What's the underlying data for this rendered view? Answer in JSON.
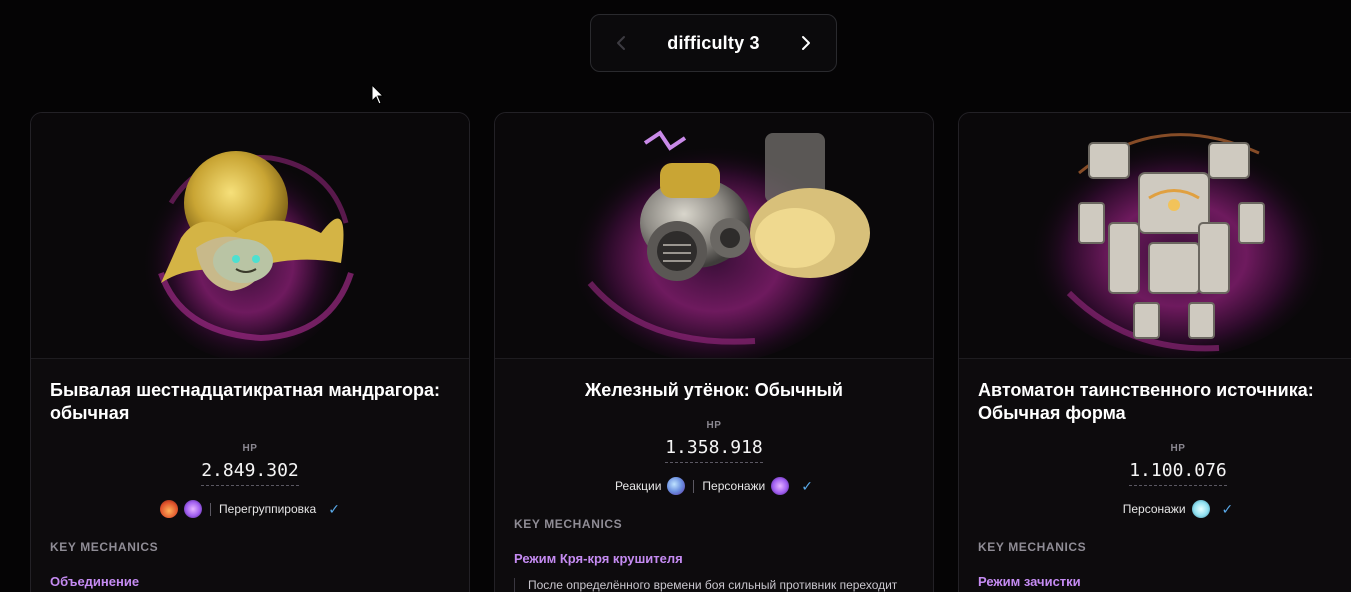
{
  "pager": {
    "title": "difficulty 3"
  },
  "cards": [
    {
      "name": "Бывалая шестнадцатикратная мандрагора: обычная",
      "hp_label": "HP",
      "hp": "2.849.302",
      "tags": {
        "label": "Перегруппировка",
        "elements": [
          "pyro-icon",
          "electro-icon"
        ]
      },
      "key_mechanics_label": "KEY MECHANICS",
      "mechanic_title": "Объединение"
    },
    {
      "name": "Железный утёнок: Обычный",
      "hp_label": "HP",
      "hp": "1.358.918",
      "tags": {
        "reactions_label": "Реакции",
        "characters_label": "Персонажи",
        "elements": [
          "swirl-icon",
          "electro-icon"
        ]
      },
      "key_mechanics_label": "KEY MECHANICS",
      "mechanic_title": "Режим Кря-кря крушителя",
      "mechanic_text": "После определённого времени боя сильный противник переходит"
    },
    {
      "name": "Автоматон таинственного источника: Обычная форма",
      "hp_label": "HP",
      "hp": "1.100.076",
      "tags": {
        "characters_label": "Персонажи",
        "elements": [
          "cryo-icon"
        ]
      },
      "key_mechanics_label": "KEY MECHANICS",
      "mechanic_title": "Режим зачистки"
    }
  ],
  "colors": {
    "accent_purple": "#c58bf2",
    "check_blue": "#59a9e8",
    "background": "#050405"
  }
}
